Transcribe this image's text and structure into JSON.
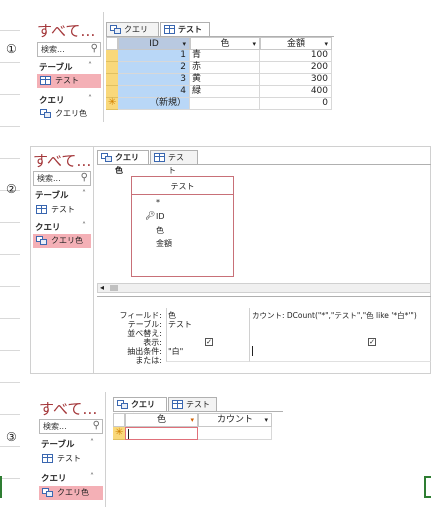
{
  "labels": {
    "one": "①",
    "two": "②",
    "three": "③"
  },
  "panel1": {
    "nav_title": "すべて…",
    "search_placeholder": "検索...",
    "group_tables": "テーブル",
    "table_item": "テスト",
    "group_queries": "クエリ",
    "query_item": "クエリ色",
    "tab_query": "クエリ色",
    "tab_table": "テスト",
    "col_id": "ID",
    "col_color": "色",
    "col_amount": "金額",
    "rows": [
      {
        "id": "1",
        "color": "青",
        "amount": "100"
      },
      {
        "id": "2",
        "color": "赤",
        "amount": "200"
      },
      {
        "id": "3",
        "color": "黄",
        "amount": "300"
      },
      {
        "id": "4",
        "color": "緑",
        "amount": "400"
      }
    ],
    "new_row": "（新規）",
    "new_amount": "0"
  },
  "panel2": {
    "nav_title": "すべて…",
    "search_placeholder": "検索...",
    "group_tables": "テーブル",
    "table_item": "テスト",
    "group_queries": "クエリ",
    "query_item": "クエリ色",
    "tab_query": "クエリ色",
    "tab_table": "テスト",
    "box_title": "テスト",
    "fields": [
      "*",
      "ID",
      "色",
      "金額"
    ],
    "grid_labels": [
      "フィールド:",
      "テーブル:",
      "並べ替え:",
      "表示:",
      "抽出条件:",
      "または:"
    ],
    "col1": {
      "field": "色",
      "table": "テスト",
      "criteria": "\"白\""
    },
    "col2": {
      "field": "カウント: DCount(\"*\",\"テスト\",\"色 like '*白*'\")"
    }
  },
  "panel3": {
    "nav_title": "すべて…",
    "search_placeholder": "検索...",
    "group_tables": "テーブル",
    "table_item": "テスト",
    "group_queries": "クエリ",
    "query_item": "クエリ色",
    "tab_query": "クエリ色",
    "tab_table": "テスト",
    "col_color": "色",
    "col_count": "カウント"
  }
}
